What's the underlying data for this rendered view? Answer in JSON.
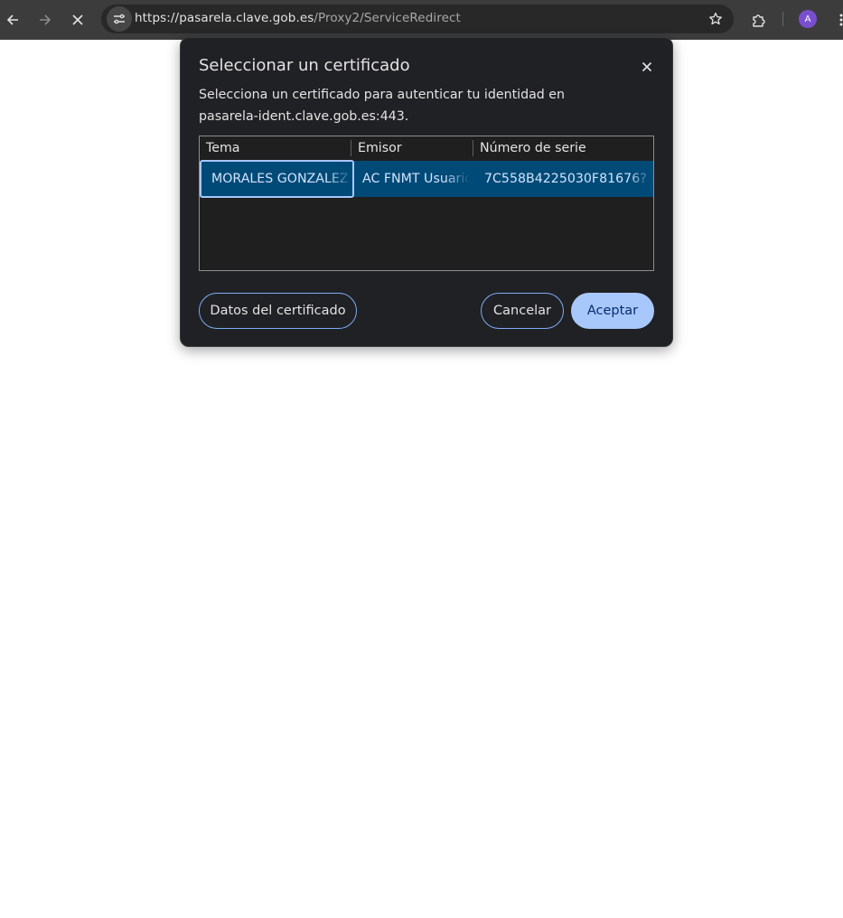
{
  "browser": {
    "back_icon": "arrow-left-icon",
    "forward_icon": "arrow-right-icon",
    "stop_icon": "close-icon",
    "site_info_icon": "tune-icon",
    "url_host": "https://pasarela.clave.gob.es",
    "url_path": "/Proxy2/ServiceRedirect",
    "bookmark_icon": "star-icon",
    "extensions_icon": "puzzle-icon",
    "avatar_letter": "A",
    "menu_icon": "more-vert-icon"
  },
  "dialog": {
    "title": "Seleccionar un certificado",
    "description": "Selecciona un certificado para autenticar tu identidad en pasarela-ident.clave.gob.es:443.",
    "columns": [
      "Tema",
      "Emisor",
      "Número de serie"
    ],
    "rows": [
      {
        "subject": "MORALES GONZALEZ",
        "issuer": "AC FNMT Usuarios",
        "serial": "7C558B4225030F81676?"
      }
    ],
    "buttons": {
      "details": "Datos del certificado",
      "cancel": "Cancelar",
      "accept": "Aceptar"
    },
    "colors": {
      "background": "#202124",
      "selected_row": "#004a77",
      "accent": "#a8c7fa"
    }
  }
}
